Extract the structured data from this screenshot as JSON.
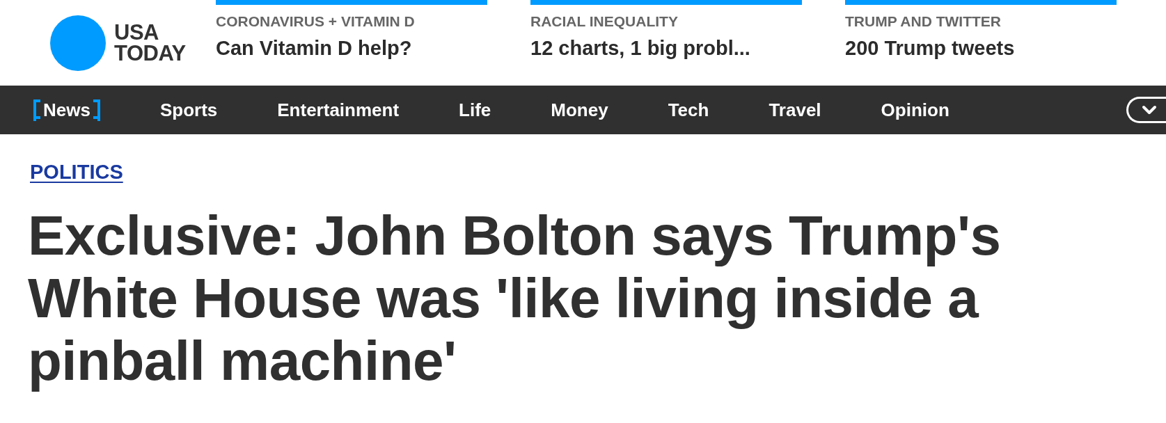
{
  "logo": {
    "text_line_1": "USA",
    "text_line_2": "TODAY"
  },
  "promos": [
    {
      "kicker": "CORONAVIRUS + VITAMIN D",
      "headline": "Can Vitamin D help?"
    },
    {
      "kicker": "RACIAL INEQUALITY",
      "headline": "12 charts, 1 big probl..."
    },
    {
      "kicker": "TRUMP AND TWITTER",
      "headline": "200 Trump tweets"
    }
  ],
  "nav": {
    "items": [
      {
        "label": "News",
        "selected": true
      },
      {
        "label": "Sports",
        "selected": false
      },
      {
        "label": "Entertainment",
        "selected": false
      },
      {
        "label": "Life",
        "selected": false
      },
      {
        "label": "Money",
        "selected": false
      },
      {
        "label": "Tech",
        "selected": false
      },
      {
        "label": "Travel",
        "selected": false
      },
      {
        "label": "Opinion",
        "selected": false
      }
    ]
  },
  "article": {
    "section": "POLITICS",
    "headline": "Exclusive: John Bolton says Trump's White House was 'like living inside a pinball machine'"
  }
}
